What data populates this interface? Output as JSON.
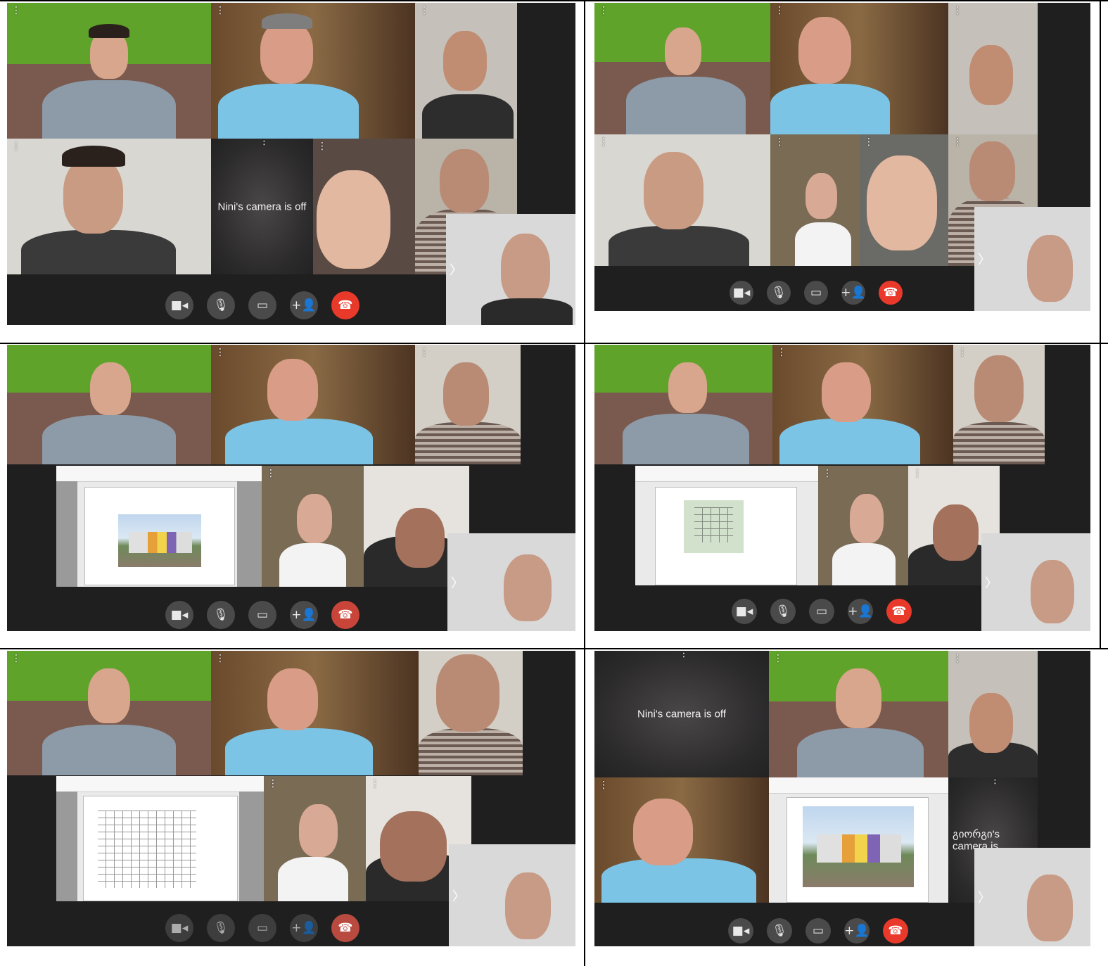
{
  "panels": [
    {
      "id": "p1",
      "camera_off_label": "Nini's camera is off"
    },
    {
      "id": "p2"
    },
    {
      "id": "p3",
      "shared_doc": "render"
    },
    {
      "id": "p4",
      "shared_doc": "siteplan"
    },
    {
      "id": "p5",
      "shared_doc": "floorplan"
    },
    {
      "id": "p6",
      "camera_off_label": "Nini's camera is off",
      "camera_off_label_2": "გიორგი's camera is"
    }
  ],
  "controls": {
    "camera": "■◂",
    "mic": "🎙",
    "screen": "▭",
    "add_people": "+👤",
    "end_call": "☎"
  },
  "icons": [
    "more-vert-icon",
    "camera-icon",
    "mic-icon",
    "screen-share-icon",
    "add-participant-icon",
    "end-call-icon",
    "chevron-right-icon"
  ],
  "colors": {
    "end_call": "#e8392b",
    "stage": "#1f1f1f",
    "button": "#4a4a4a"
  }
}
